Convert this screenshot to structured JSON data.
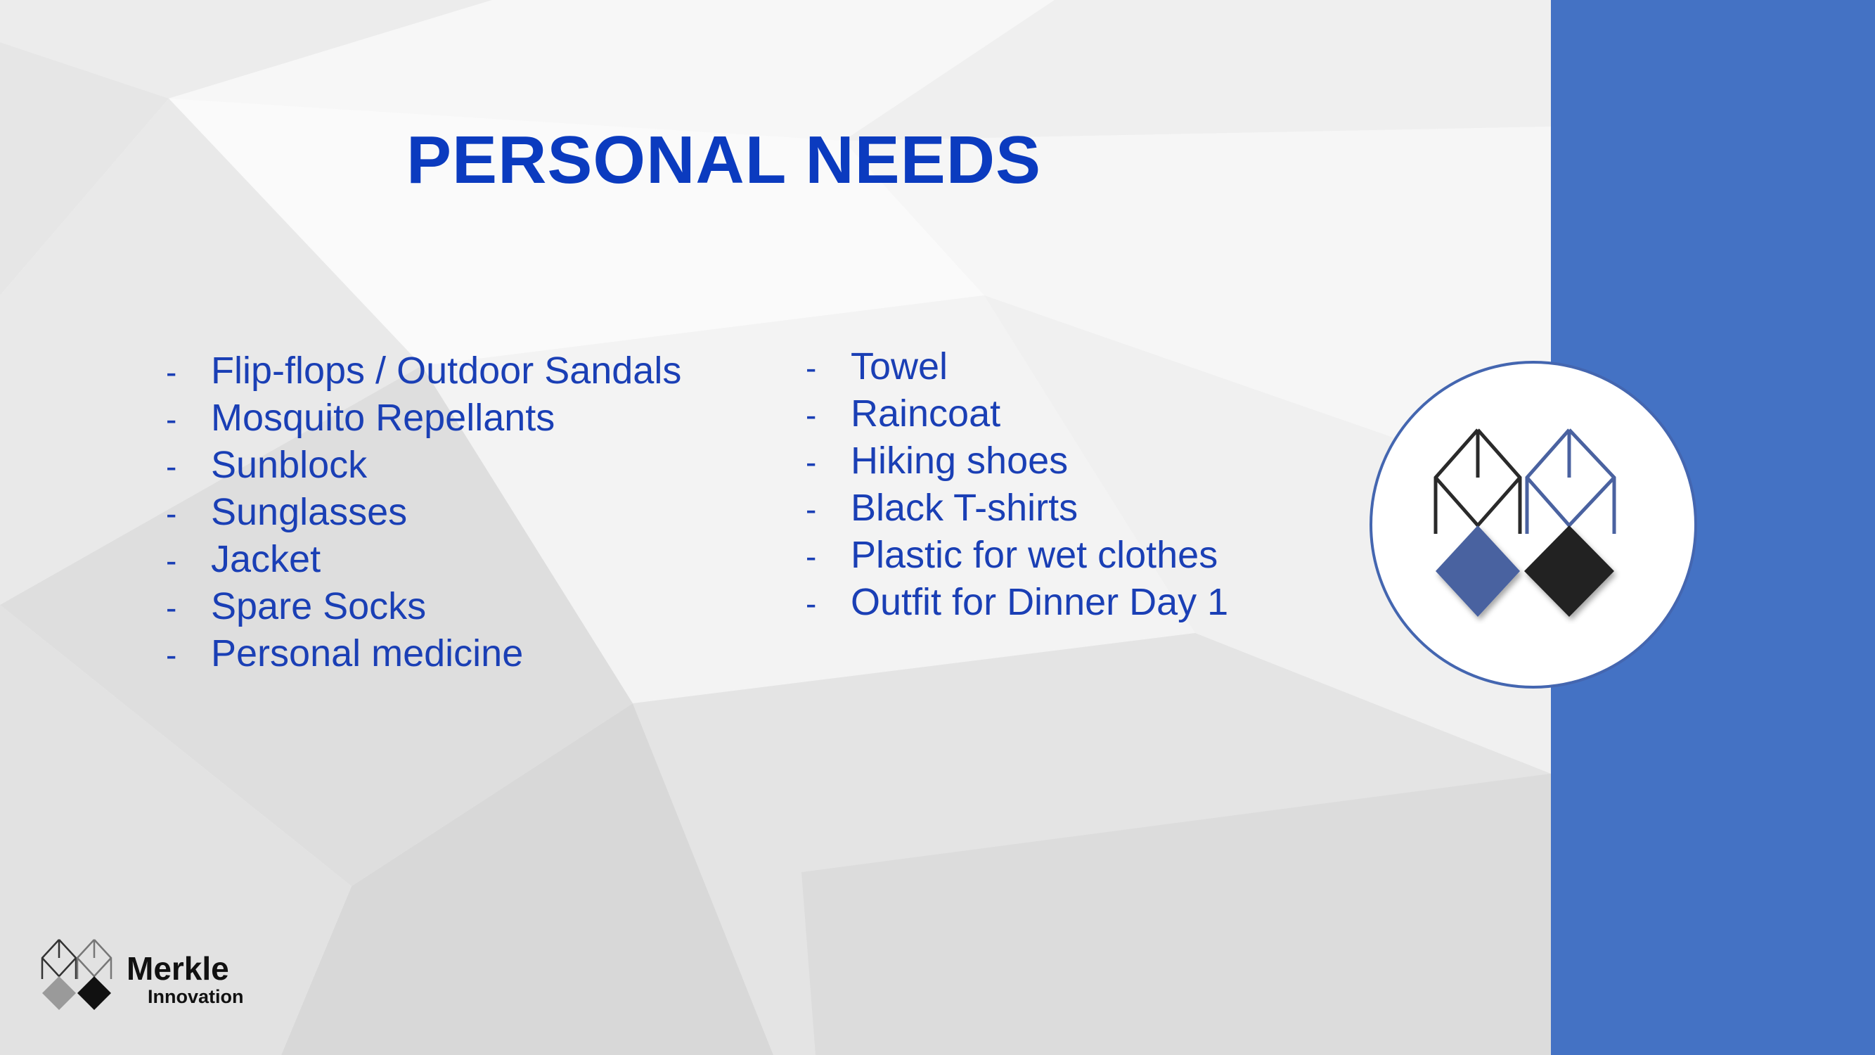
{
  "slide": {
    "title": "PERSONAL NEEDS",
    "left_items": [
      "Flip-flops / Outdoor Sandals",
      "Mosquito Repellants",
      "Sunblock",
      "Sunglasses",
      "Jacket",
      "Spare Socks",
      "Personal medicine"
    ],
    "right_items": [
      "Towel",
      "Raincoat",
      "Hiking shoes",
      "Black T-shirts",
      "Plastic for wet clothes",
      "Outfit for Dinner Day 1"
    ],
    "bullet": "-"
  },
  "brand": {
    "name": "Merkle",
    "sub": "Innovation",
    "logo_icon": "merkle-diamond-logo-icon"
  },
  "colors": {
    "title": "#0b3bbf",
    "text": "#1a3fb5",
    "accent_band": "#4472c4",
    "logo_blue": "#4a62a0",
    "logo_black": "#222222"
  }
}
